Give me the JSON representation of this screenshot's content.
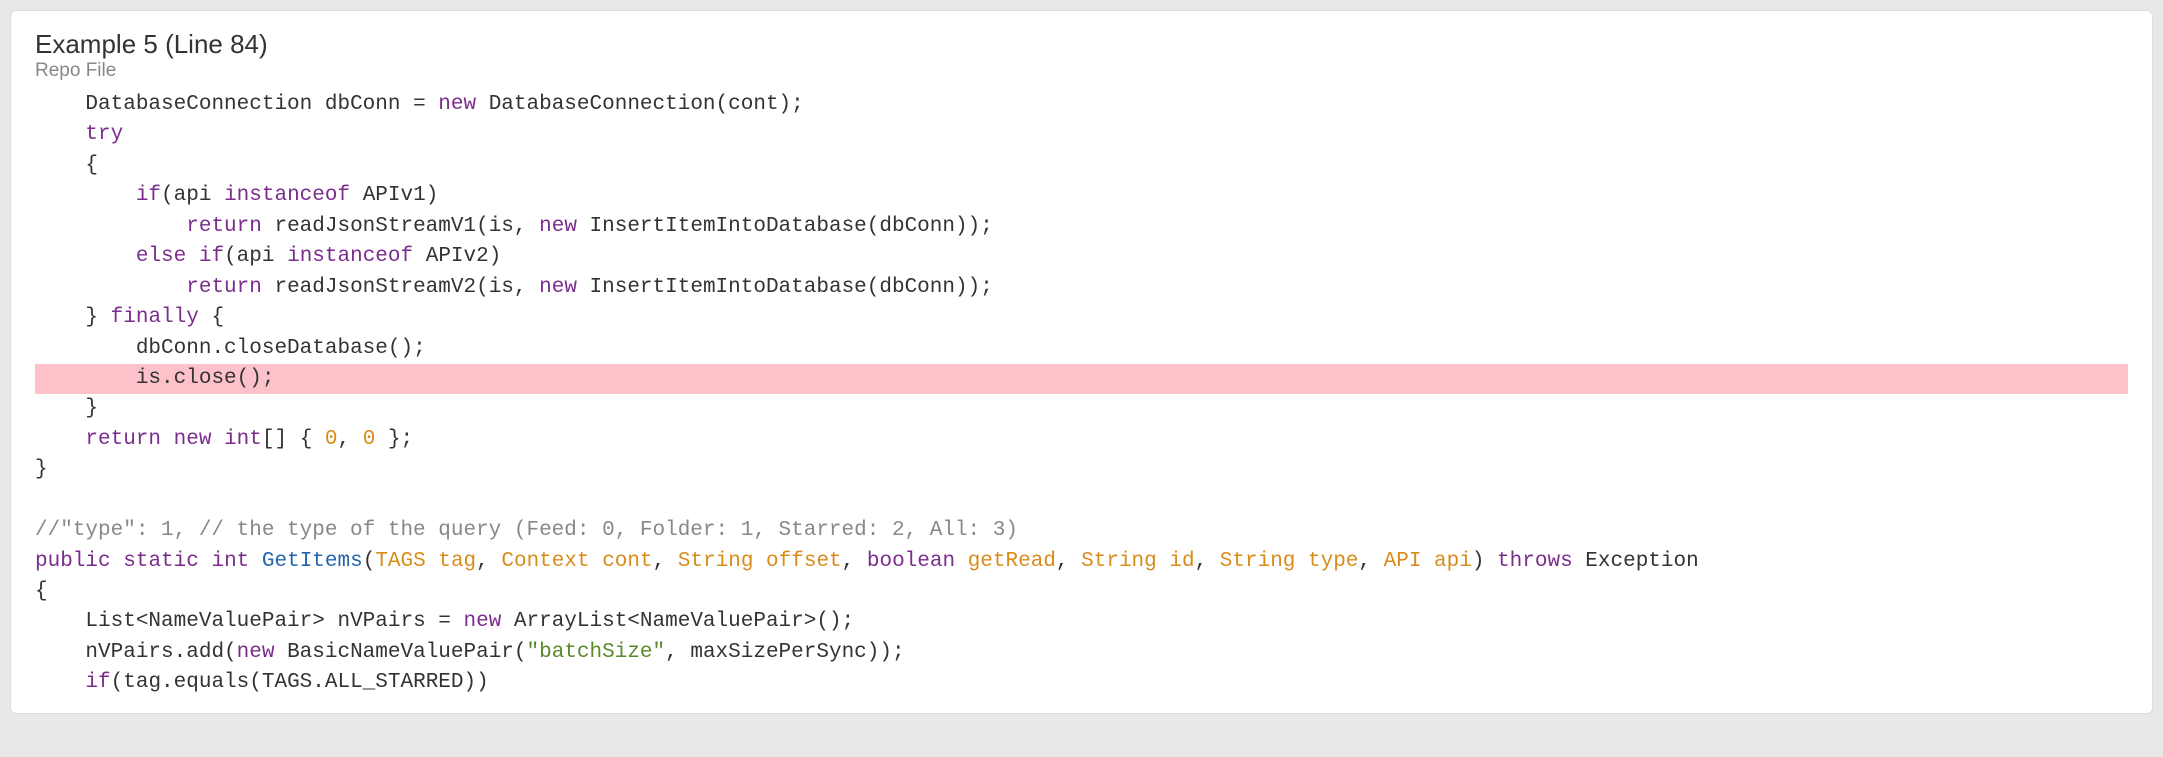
{
  "header": {
    "title": "Example 5 (Line 84)",
    "subtitle": "Repo File"
  },
  "code": {
    "lines": [
      {
        "indent": "    ",
        "tokens": [
          [
            "",
            "DatabaseConnection dbConn = "
          ],
          [
            "kw",
            "new"
          ],
          [
            "",
            " DatabaseConnection(cont);"
          ]
        ],
        "hl": false
      },
      {
        "indent": "    ",
        "tokens": [
          [
            "kw",
            "try"
          ]
        ],
        "hl": false
      },
      {
        "indent": "    ",
        "tokens": [
          [
            "",
            "{"
          ]
        ],
        "hl": false
      },
      {
        "indent": "        ",
        "tokens": [
          [
            "kw",
            "if"
          ],
          [
            "",
            "(api "
          ],
          [
            "kw",
            "instanceof"
          ],
          [
            "",
            " APIv1)"
          ]
        ],
        "hl": false
      },
      {
        "indent": "            ",
        "tokens": [
          [
            "kw",
            "return"
          ],
          [
            "",
            " readJsonStreamV1(is, "
          ],
          [
            "kw",
            "new"
          ],
          [
            "",
            " InsertItemIntoDatabase(dbConn));"
          ]
        ],
        "hl": false
      },
      {
        "indent": "        ",
        "tokens": [
          [
            "kw",
            "else"
          ],
          [
            "",
            " "
          ],
          [
            "kw",
            "if"
          ],
          [
            "",
            "(api "
          ],
          [
            "kw",
            "instanceof"
          ],
          [
            "",
            " APIv2)"
          ]
        ],
        "hl": false
      },
      {
        "indent": "            ",
        "tokens": [
          [
            "kw",
            "return"
          ],
          [
            "",
            " readJsonStreamV2(is, "
          ],
          [
            "kw",
            "new"
          ],
          [
            "",
            " InsertItemIntoDatabase(dbConn));"
          ]
        ],
        "hl": false
      },
      {
        "indent": "    ",
        "tokens": [
          [
            "",
            "} "
          ],
          [
            "kw",
            "finally"
          ],
          [
            "",
            " {"
          ]
        ],
        "hl": false
      },
      {
        "indent": "        ",
        "tokens": [
          [
            "",
            "dbConn.closeDatabase();"
          ]
        ],
        "hl": false
      },
      {
        "indent": "        ",
        "tokens": [
          [
            "",
            "is.close();"
          ]
        ],
        "hl": true
      },
      {
        "indent": "    ",
        "tokens": [
          [
            "",
            "}"
          ]
        ],
        "hl": false
      },
      {
        "indent": "    ",
        "tokens": [
          [
            "kw",
            "return"
          ],
          [
            "",
            " "
          ],
          [
            "kw",
            "new"
          ],
          [
            "",
            " "
          ],
          [
            "kw",
            "int"
          ],
          [
            "",
            "[] { "
          ],
          [
            "par",
            "0"
          ],
          [
            "",
            ", "
          ],
          [
            "par",
            "0"
          ],
          [
            "",
            " };"
          ]
        ],
        "hl": false
      },
      {
        "indent": "",
        "tokens": [
          [
            "",
            "}"
          ]
        ],
        "hl": false
      },
      {
        "indent": "",
        "tokens": [
          [
            "",
            ""
          ]
        ],
        "hl": false
      },
      {
        "indent": "",
        "tokens": [
          [
            "cm",
            "//\"type\": 1, // the type of the query (Feed: 0, Folder: 1, Starred: 2, All: 3)"
          ]
        ],
        "hl": false
      },
      {
        "indent": "",
        "tokens": [
          [
            "kw",
            "public"
          ],
          [
            "",
            " "
          ],
          [
            "kw",
            "static"
          ],
          [
            "",
            " "
          ],
          [
            "kw",
            "int"
          ],
          [
            "",
            " "
          ],
          [
            "fn",
            "GetItems"
          ],
          [
            "",
            "("
          ],
          [
            "par",
            "TAGS tag"
          ],
          [
            "",
            ", "
          ],
          [
            "par",
            "Context cont"
          ],
          [
            "",
            ", "
          ],
          [
            "par",
            "String offset"
          ],
          [
            "",
            ", "
          ],
          [
            "kw",
            "boolean"
          ],
          [
            "",
            " "
          ],
          [
            "par",
            "getRead"
          ],
          [
            "",
            ", "
          ],
          [
            "par",
            "String id"
          ],
          [
            "",
            ", "
          ],
          [
            "par",
            "String type"
          ],
          [
            "",
            ", "
          ],
          [
            "par",
            "API api"
          ],
          [
            "",
            ") "
          ],
          [
            "kw",
            "throws"
          ],
          [
            "",
            " Exception"
          ]
        ],
        "hl": false
      },
      {
        "indent": "",
        "tokens": [
          [
            "",
            "{"
          ]
        ],
        "hl": false
      },
      {
        "indent": "    ",
        "tokens": [
          [
            "",
            "List<NameValuePair> nVPairs = "
          ],
          [
            "kw",
            "new"
          ],
          [
            "",
            " ArrayList<NameValuePair>();"
          ]
        ],
        "hl": false
      },
      {
        "indent": "    ",
        "tokens": [
          [
            "",
            "nVPairs.add("
          ],
          [
            "kw",
            "new"
          ],
          [
            "",
            " BasicNameValuePair("
          ],
          [
            "str",
            "\"batchSize\""
          ],
          [
            "",
            ", maxSizePerSync));"
          ]
        ],
        "hl": false
      },
      {
        "indent": "    ",
        "tokens": [
          [
            "kw",
            "if"
          ],
          [
            "",
            "(tag.equals(TAGS.ALL_STARRED))"
          ]
        ],
        "hl": false
      }
    ]
  }
}
